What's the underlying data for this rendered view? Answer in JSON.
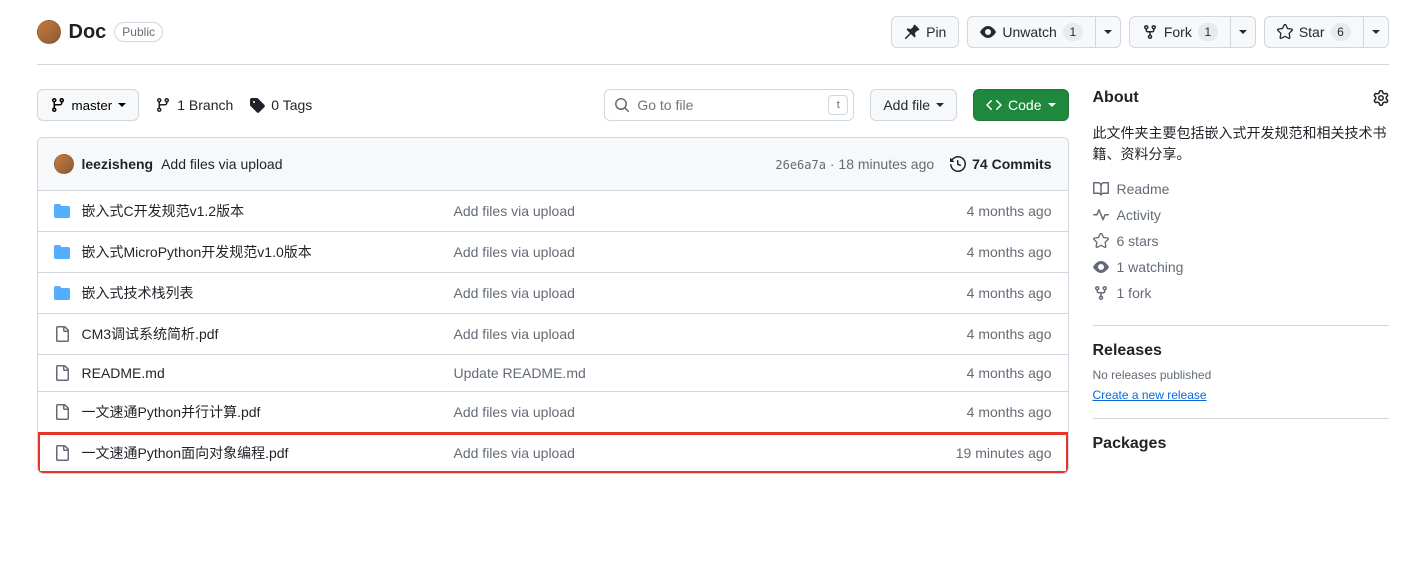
{
  "header": {
    "repo_name": "Doc",
    "visibility": "Public",
    "pin_label": "Pin",
    "unwatch_label": "Unwatch",
    "unwatch_count": "1",
    "fork_label": "Fork",
    "fork_count": "1",
    "star_label": "Star",
    "star_count": "6"
  },
  "toolbar": {
    "branch": "master",
    "branch_count": "1 Branch",
    "tag_count": "0 Tags",
    "search_placeholder": "Go to file",
    "key_hint": "t",
    "add_file": "Add file",
    "code": "Code"
  },
  "commit_header": {
    "author": "leezisheng",
    "message": "Add files via upload",
    "hash": "26e6a7a",
    "sep": " · ",
    "time": "18 minutes ago",
    "commits": "74 Commits"
  },
  "files": [
    {
      "type": "dir",
      "name": "嵌入式C开发规范v1.2版本",
      "msg": "Add files via upload",
      "date": "4 months ago"
    },
    {
      "type": "dir",
      "name": "嵌入式MicroPython开发规范v1.0版本",
      "msg": "Add files via upload",
      "date": "4 months ago"
    },
    {
      "type": "dir",
      "name": "嵌入式技术栈列表",
      "msg": "Add files via upload",
      "date": "4 months ago"
    },
    {
      "type": "file",
      "name": "CM3调试系统简析.pdf",
      "msg": "Add files via upload",
      "date": "4 months ago"
    },
    {
      "type": "file",
      "name": "README.md",
      "msg": "Update README.md",
      "date": "4 months ago"
    },
    {
      "type": "file",
      "name": "一文速通Python并行计算.pdf",
      "msg": "Add files via upload",
      "date": "4 months ago"
    },
    {
      "type": "file",
      "name": "一文速通Python面向对象编程.pdf",
      "msg": "Add files via upload",
      "date": "19 minutes ago",
      "highlighted": true
    }
  ],
  "about": {
    "title": "About",
    "description": "此文件夹主要包括嵌入式开发规范和相关技术书籍、资料分享。",
    "readme": "Readme",
    "activity": "Activity",
    "stars": "6 stars",
    "watching": "1 watching",
    "forks": "1 fork"
  },
  "releases": {
    "title": "Releases",
    "none": "No releases published",
    "create": "Create a new release"
  },
  "packages": {
    "title": "Packages"
  }
}
